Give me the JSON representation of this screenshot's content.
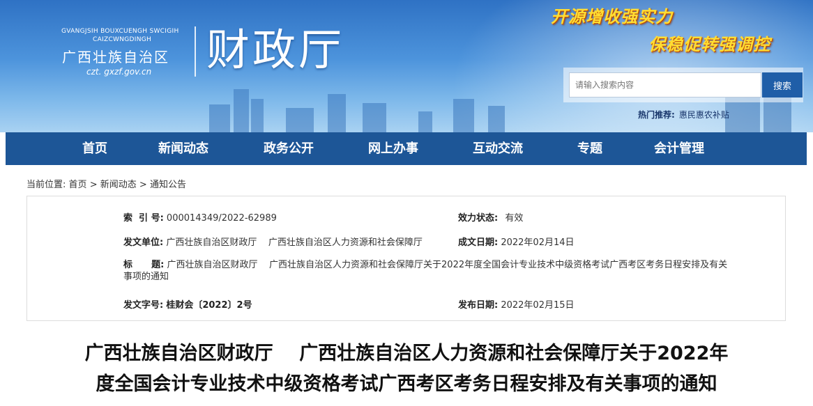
{
  "header": {
    "logo_en_line1": "GVANGJSIH BOUXCUENGH SWCIGIH",
    "logo_en_line2": "CAIZCWNGDINGH",
    "logo_cn": "广西壮族自治区",
    "logo_url": "czt. gxzf.gov.cn",
    "logo_main": "财政厅",
    "slogan_1": "开源增收强实力",
    "slogan_2": "保稳促转强调控"
  },
  "search": {
    "placeholder": "请输入搜索内容",
    "button_label": "搜索",
    "hot_label": "热门推荐:",
    "hot_items": [
      "惠民惠农补贴"
    ]
  },
  "nav": {
    "items": [
      "首页",
      "新闻动态",
      "政务公开",
      "网上办事",
      "互动交流",
      "专题",
      "会计管理"
    ]
  },
  "breadcrumb": {
    "prefix": "当前位置:",
    "items": [
      "首页",
      "新闻动态",
      "通知公告"
    ],
    "separator": ">"
  },
  "meta": {
    "index_label": "索  引 号:",
    "index_value": "000014349/2022-62989",
    "status_label": "效力状态:",
    "status_value": "有效",
    "issuer_label": "发文单位:",
    "issuer_value": "广西壮族自治区财政厅    广西壮族自治区人力资源和社会保障厅",
    "created_label": "成文日期:",
    "created_value": "2022年02月14日",
    "title_label": "标      题:",
    "title_value_line1": "广西壮族自治区财政厅    广西壮族自治区人力资源和社会保障厅关于2022年度全国会计专业技术中级资格考试广西考区考务日程安排及有关",
    "title_value_line2": "事项的通知",
    "docno_label": "发文字号:",
    "docno_value": "桂财会〔2022〕2号",
    "published_label": "发布日期:",
    "published_value": "2022年02月15日"
  },
  "article": {
    "title_line1": "广西壮族自治区财政厅    广西壮族自治区人力资源和社会保障厅关于2022年",
    "title_line2": "度全国会计专业技术中级资格考试广西考区考务日程安排及有关事项的通知"
  },
  "colors": {
    "nav_bg": "#1d5697",
    "search_button": "#1f5ea8",
    "slogan": "#ffdd33",
    "header_blue": "#2f72c4"
  }
}
